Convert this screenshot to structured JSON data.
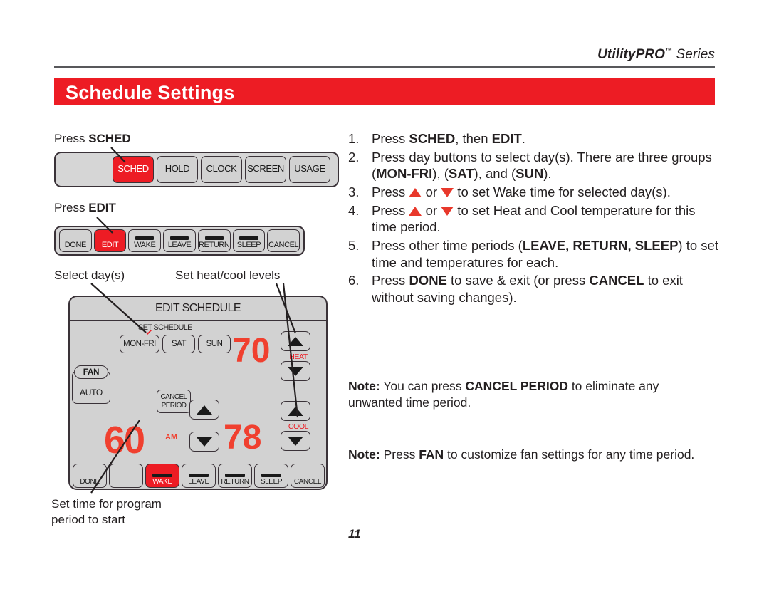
{
  "header": {
    "series": "UtilityPRO",
    "series_tm": "™",
    "series_suffix": " Series",
    "title": "Schedule Settings",
    "accent_color": "#ED1C24"
  },
  "left": {
    "press_sched_label_prefix": "Press ",
    "press_sched_label_bold": "SCHED",
    "press_edit_label_prefix": "Press ",
    "press_edit_label_bold": "EDIT",
    "callout_select_days": "Select day(s)",
    "callout_set_levels": "Set heat/cool levels",
    "callout_set_time_line1": "Set time for program",
    "callout_set_time_line2": "period to start"
  },
  "sched_bar": {
    "buttons": [
      {
        "label": "",
        "state": "blank"
      },
      {
        "label": "SCHED",
        "state": "active"
      },
      {
        "label": "HOLD",
        "state": "normal"
      },
      {
        "label": "CLOCK",
        "state": "normal"
      },
      {
        "label": "SCREEN",
        "state": "normal"
      },
      {
        "label": "USAGE",
        "state": "normal"
      }
    ]
  },
  "edit_bar": {
    "buttons": [
      {
        "label": "DONE",
        "state": "normal",
        "bar": false
      },
      {
        "label": "EDIT",
        "state": "active",
        "bar": false
      },
      {
        "label": "WAKE",
        "state": "normal",
        "bar": true
      },
      {
        "label": "LEAVE",
        "state": "normal",
        "bar": true
      },
      {
        "label": "RETURN",
        "state": "normal",
        "bar": true
      },
      {
        "label": "SLEEP",
        "state": "normal",
        "bar": true
      },
      {
        "label": "CANCEL",
        "state": "normal",
        "bar": false
      }
    ]
  },
  "thermostat": {
    "header_title": "EDIT SCHEDULE",
    "set_schedule_label": "SET SCHEDULE",
    "days": [
      {
        "label": "MON-FRI",
        "selected": true
      },
      {
        "label": "SAT",
        "selected": false
      },
      {
        "label": "SUN",
        "selected": false
      }
    ],
    "checkmark": "✓",
    "fan_label": "FAN",
    "fan_mode": "AUTO",
    "cancel_period_line1": "CANCEL",
    "cancel_period_line2": "PERIOD",
    "display": {
      "heat_setpoint": "70",
      "cool_setpoint": "78",
      "time": "60",
      "am_pm": "AM"
    },
    "heat_label": "HEAT",
    "cool_label": "COOL",
    "bottom_buttons": [
      {
        "label": "DONE",
        "state": "normal",
        "bar": false
      },
      {
        "label": "",
        "state": "blank",
        "bar": false
      },
      {
        "label": "WAKE",
        "state": "active",
        "bar": true
      },
      {
        "label": "LEAVE",
        "state": "normal",
        "bar": true
      },
      {
        "label": "RETURN",
        "state": "normal",
        "bar": true
      },
      {
        "label": "SLEEP",
        "state": "normal",
        "bar": true
      },
      {
        "label": "CANCEL",
        "state": "normal",
        "bar": false
      }
    ]
  },
  "instructions": {
    "steps": [
      {
        "num": "1.",
        "html": "Press <b>SCHED</b>, then <b>EDIT</b>."
      },
      {
        "num": "2.",
        "html": "Press day buttons to select day(s). There are three groups (<b>MON-FRI</b>), (<b>SAT</b>), and (<b>SUN</b>)."
      },
      {
        "num": "3.",
        "html": "Press <span class=\"tri-red-up\"></span> or <span class=\"tri-red-dn\"></span> to set Wake time for selected day(s)."
      },
      {
        "num": "4.",
        "html": "Press <span class=\"tri-red-up\"></span> or <span class=\"tri-red-dn\"></span> to set Heat and Cool temperature for this time period."
      },
      {
        "num": "5.",
        "html": "Press other time periods (<b>LEAVE, RETURN, SLEEP</b>) to set time and temperatures for each."
      },
      {
        "num": "6.",
        "html": "Press <b>DONE</b> to save &amp; exit (or press <b>CANCEL</b> to exit without saving changes)."
      }
    ],
    "note1_html": "<b>Note:</b> You can press <b>CANCEL PERIOD</b> to eliminate any unwanted time period.",
    "note2_html": "<b>Note:</b> Press <b>FAN</b> to customize fan settings for any time period."
  },
  "footer": {
    "page_number": "11"
  }
}
